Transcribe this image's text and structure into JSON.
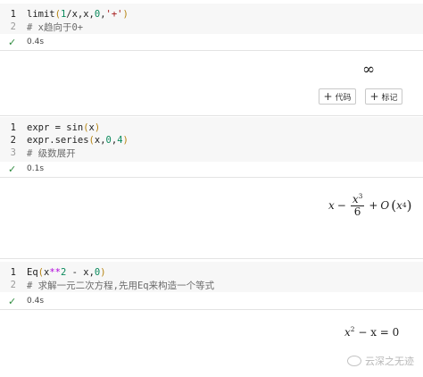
{
  "cell1": {
    "line1_number": "1",
    "line1": {
      "fn": "limit",
      "open": "(",
      "n1": "1",
      "mid": "/x,x,",
      "n2": "0",
      "sep": ",",
      "str": "'+'",
      "close": ")"
    },
    "line2_number": "2",
    "line2_comment": "# x趋向于0+",
    "status_time": "0.4s",
    "output": "∞"
  },
  "toolbar": {
    "add_code_label": "代码",
    "add_markdown_label": "标记"
  },
  "cell2": {
    "line1_number": "1",
    "line1": {
      "text": "expr = sin",
      "open": "(",
      "arg": "x",
      "close": ")"
    },
    "line2_number": "2",
    "line2": {
      "text": "expr.series",
      "open": "(",
      "a": "x,",
      "n1": "0",
      "sep": ",",
      "n2": "4",
      "close": ")"
    },
    "line3_number": "3",
    "line3_comment": "# 级数展开",
    "status_time": "0.1s",
    "output": {
      "x": "x",
      "minus": "−",
      "num": "x",
      "num_exp": "3",
      "den": "6",
      "plus": "+",
      "O": "O",
      "oarg": "x",
      "oarg_exp": "4"
    }
  },
  "cell3": {
    "line1_number": "1",
    "line1": {
      "fn": "Eq",
      "open": "(",
      "a": "x",
      "op": "**",
      "n1": "2",
      "b": " - x,",
      "n2": "0",
      "close": ")"
    },
    "line2_number": "2",
    "line2_comment": "# 求解一元二次方程,先用Eq来构造一个等式",
    "status_time": "0.4s",
    "output": {
      "x": "x",
      "exp": "2",
      "rest": "− x = 0"
    }
  },
  "watermark": {
    "text": "云深之无迹",
    "icon": "wechat-icon"
  },
  "colors": {
    "check": "#2e8b3e",
    "paren": "#b5830f",
    "number": "#0b8a5c",
    "string": "#a31515",
    "operator": "#af00db"
  }
}
